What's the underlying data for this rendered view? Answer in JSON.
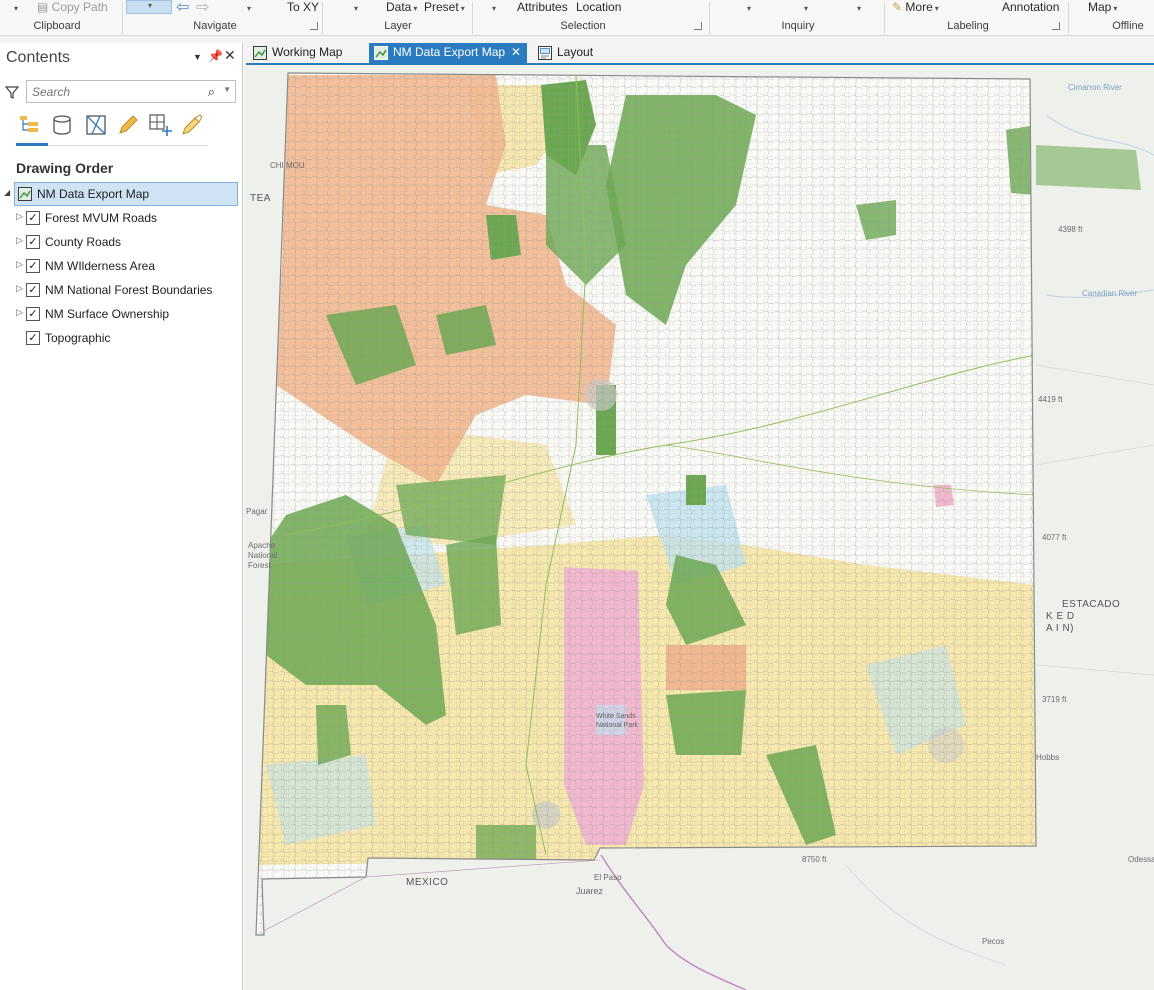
{
  "ribbon": {
    "clipboard": {
      "copy_path": "Copy Path",
      "group": "Clipboard"
    },
    "navigate": {
      "to_xy": "To XY",
      "group": "Navigate"
    },
    "layer": {
      "data": "Data",
      "preset": "Preset",
      "group": "Layer"
    },
    "selection": {
      "attributes": "Attributes",
      "location": "Location",
      "group": "Selection"
    },
    "inquiry": {
      "group": "Inquiry"
    },
    "labeling": {
      "more": "More",
      "annotation": "Annotation",
      "group": "Labeling"
    },
    "offline": {
      "map": "Map",
      "group": "Offline"
    }
  },
  "contents": {
    "title": "Contents",
    "search_placeholder": "Search",
    "drawing_order": "Drawing Order",
    "map_name": "NM Data Export Map",
    "layers": [
      {
        "label": "Forest MVUM Roads",
        "checked": true
      },
      {
        "label": "County Roads",
        "checked": true
      },
      {
        "label": "NM WIlderness Area",
        "checked": true
      },
      {
        "label": "NM National Forest Boundaries",
        "checked": true
      },
      {
        "label": "NM Surface Ownership",
        "checked": true
      },
      {
        "label": "Topographic",
        "checked": true
      }
    ]
  },
  "tabs": [
    {
      "label": "Working Map",
      "active": false
    },
    {
      "label": "NM Data Export Map",
      "active": true
    },
    {
      "label": "Layout",
      "active": false
    }
  ],
  "map": {
    "labels": {
      "mexico": "MEXICO",
      "juarez": "Juarez",
      "el_paso": "El Paso",
      "pecos": "Pecos",
      "odessa": "Odessa",
      "hobbs": "Hobbs",
      "canadian_river": "Canadian River",
      "cimarron_river": "Cimarron River",
      "estacado": "ESTACADO",
      "staked": "K E D",
      "plain": "A I N)",
      "elev_4398": "4398 ft",
      "elev_4419": "4419 ft",
      "elev_4077": "4077 ft",
      "elev_3719": "3719 ft",
      "elev_8750": "8750 ft",
      "pagar": "Pagar",
      "apache": "Apache",
      "national": "National",
      "forest": "Forest",
      "white_sands": "White Sands",
      "national_park": "National Park",
      "chi_mou": "CHI MOU",
      "tea": "TEA"
    },
    "colors": {
      "basemap": "#eef0ec",
      "forest_green": "#6aa84f",
      "blm_yellow": "#f6e4a0",
      "tribal_orange": "#f3b890",
      "military_pink": "#f2b8cf",
      "state_blue": "#bfe2ef",
      "roads": "#9a9a9a",
      "accent": "#2b7bc1"
    }
  }
}
